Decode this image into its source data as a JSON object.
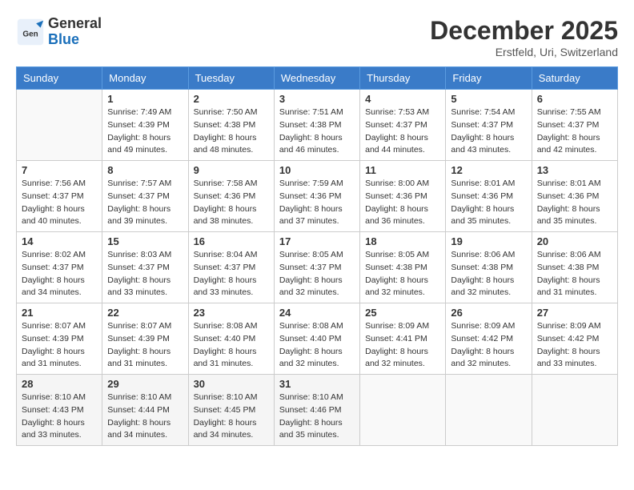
{
  "header": {
    "logo": {
      "general": "General",
      "blue": "Blue"
    },
    "title": "December 2025",
    "location": "Erstfeld, Uri, Switzerland"
  },
  "days_of_week": [
    "Sunday",
    "Monday",
    "Tuesday",
    "Wednesday",
    "Thursday",
    "Friday",
    "Saturday"
  ],
  "weeks": [
    [
      {
        "day": "",
        "info": ""
      },
      {
        "day": "1",
        "info": "Sunrise: 7:49 AM\nSunset: 4:39 PM\nDaylight: 8 hours\nand 49 minutes."
      },
      {
        "day": "2",
        "info": "Sunrise: 7:50 AM\nSunset: 4:38 PM\nDaylight: 8 hours\nand 48 minutes."
      },
      {
        "day": "3",
        "info": "Sunrise: 7:51 AM\nSunset: 4:38 PM\nDaylight: 8 hours\nand 46 minutes."
      },
      {
        "day": "4",
        "info": "Sunrise: 7:53 AM\nSunset: 4:37 PM\nDaylight: 8 hours\nand 44 minutes."
      },
      {
        "day": "5",
        "info": "Sunrise: 7:54 AM\nSunset: 4:37 PM\nDaylight: 8 hours\nand 43 minutes."
      },
      {
        "day": "6",
        "info": "Sunrise: 7:55 AM\nSunset: 4:37 PM\nDaylight: 8 hours\nand 42 minutes."
      }
    ],
    [
      {
        "day": "7",
        "info": "Sunrise: 7:56 AM\nSunset: 4:37 PM\nDaylight: 8 hours\nand 40 minutes."
      },
      {
        "day": "8",
        "info": "Sunrise: 7:57 AM\nSunset: 4:37 PM\nDaylight: 8 hours\nand 39 minutes."
      },
      {
        "day": "9",
        "info": "Sunrise: 7:58 AM\nSunset: 4:36 PM\nDaylight: 8 hours\nand 38 minutes."
      },
      {
        "day": "10",
        "info": "Sunrise: 7:59 AM\nSunset: 4:36 PM\nDaylight: 8 hours\nand 37 minutes."
      },
      {
        "day": "11",
        "info": "Sunrise: 8:00 AM\nSunset: 4:36 PM\nDaylight: 8 hours\nand 36 minutes."
      },
      {
        "day": "12",
        "info": "Sunrise: 8:01 AM\nSunset: 4:36 PM\nDaylight: 8 hours\nand 35 minutes."
      },
      {
        "day": "13",
        "info": "Sunrise: 8:01 AM\nSunset: 4:36 PM\nDaylight: 8 hours\nand 35 minutes."
      }
    ],
    [
      {
        "day": "14",
        "info": "Sunrise: 8:02 AM\nSunset: 4:37 PM\nDaylight: 8 hours\nand 34 minutes."
      },
      {
        "day": "15",
        "info": "Sunrise: 8:03 AM\nSunset: 4:37 PM\nDaylight: 8 hours\nand 33 minutes."
      },
      {
        "day": "16",
        "info": "Sunrise: 8:04 AM\nSunset: 4:37 PM\nDaylight: 8 hours\nand 33 minutes."
      },
      {
        "day": "17",
        "info": "Sunrise: 8:05 AM\nSunset: 4:37 PM\nDaylight: 8 hours\nand 32 minutes."
      },
      {
        "day": "18",
        "info": "Sunrise: 8:05 AM\nSunset: 4:38 PM\nDaylight: 8 hours\nand 32 minutes."
      },
      {
        "day": "19",
        "info": "Sunrise: 8:06 AM\nSunset: 4:38 PM\nDaylight: 8 hours\nand 32 minutes."
      },
      {
        "day": "20",
        "info": "Sunrise: 8:06 AM\nSunset: 4:38 PM\nDaylight: 8 hours\nand 31 minutes."
      }
    ],
    [
      {
        "day": "21",
        "info": "Sunrise: 8:07 AM\nSunset: 4:39 PM\nDaylight: 8 hours\nand 31 minutes."
      },
      {
        "day": "22",
        "info": "Sunrise: 8:07 AM\nSunset: 4:39 PM\nDaylight: 8 hours\nand 31 minutes."
      },
      {
        "day": "23",
        "info": "Sunrise: 8:08 AM\nSunset: 4:40 PM\nDaylight: 8 hours\nand 31 minutes."
      },
      {
        "day": "24",
        "info": "Sunrise: 8:08 AM\nSunset: 4:40 PM\nDaylight: 8 hours\nand 32 minutes."
      },
      {
        "day": "25",
        "info": "Sunrise: 8:09 AM\nSunset: 4:41 PM\nDaylight: 8 hours\nand 32 minutes."
      },
      {
        "day": "26",
        "info": "Sunrise: 8:09 AM\nSunset: 4:42 PM\nDaylight: 8 hours\nand 32 minutes."
      },
      {
        "day": "27",
        "info": "Sunrise: 8:09 AM\nSunset: 4:42 PM\nDaylight: 8 hours\nand 33 minutes."
      }
    ],
    [
      {
        "day": "28",
        "info": "Sunrise: 8:10 AM\nSunset: 4:43 PM\nDaylight: 8 hours\nand 33 minutes."
      },
      {
        "day": "29",
        "info": "Sunrise: 8:10 AM\nSunset: 4:44 PM\nDaylight: 8 hours\nand 34 minutes."
      },
      {
        "day": "30",
        "info": "Sunrise: 8:10 AM\nSunset: 4:45 PM\nDaylight: 8 hours\nand 34 minutes."
      },
      {
        "day": "31",
        "info": "Sunrise: 8:10 AM\nSunset: 4:46 PM\nDaylight: 8 hours\nand 35 minutes."
      },
      {
        "day": "",
        "info": ""
      },
      {
        "day": "",
        "info": ""
      },
      {
        "day": "",
        "info": ""
      }
    ]
  ]
}
